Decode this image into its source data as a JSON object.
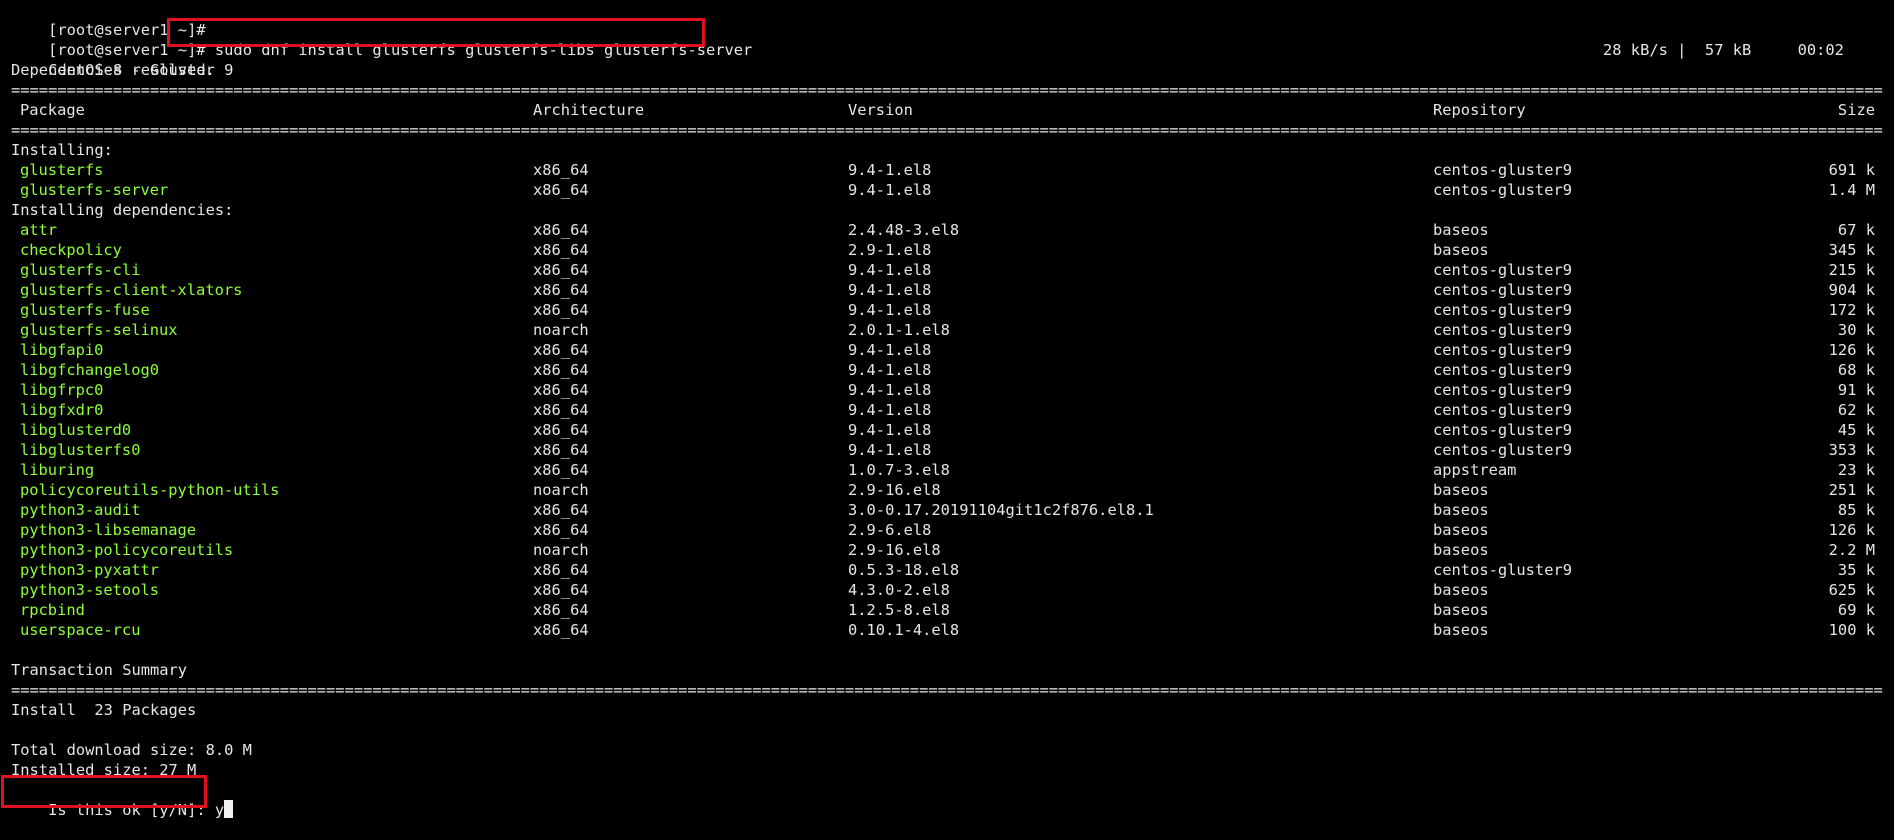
{
  "terminal": {
    "lines": {
      "prompt1": "[root@server1 ~]#",
      "prompt2": "[root@server1 ~]#",
      "command": "sudo dnf install glusterfs glusterfs-libs glusterfs-server",
      "repo_line": "CentOS-8 - Gluster 9",
      "download_stats": "28 kB/s |  57 kB     00:02",
      "deps_resolved": "Dependencies resolved.",
      "installing_header": "Installing:",
      "installing_deps_header": "Installing dependencies:",
      "transaction_summary": "Transaction Summary",
      "install_count": "Install  23 Packages",
      "total_download": "Total download size: 8.0 M",
      "installed_size": "Installed size: 27 M",
      "confirm_prompt": "Is this ok [y/N]: ",
      "confirm_answer": "y"
    },
    "table_headers": {
      "package": "Package",
      "architecture": "Architecture",
      "version": "Version",
      "repository": "Repository",
      "size": "Size"
    },
    "installing": [
      {
        "name": "glusterfs",
        "arch": "x86_64",
        "version": "9.4-1.el8",
        "repo": "centos-gluster9",
        "size": "691 k"
      },
      {
        "name": "glusterfs-server",
        "arch": "x86_64",
        "version": "9.4-1.el8",
        "repo": "centos-gluster9",
        "size": "1.4 M"
      }
    ],
    "dependencies": [
      {
        "name": "attr",
        "arch": "x86_64",
        "version": "2.4.48-3.el8",
        "repo": "baseos",
        "size": "67 k"
      },
      {
        "name": "checkpolicy",
        "arch": "x86_64",
        "version": "2.9-1.el8",
        "repo": "baseos",
        "size": "345 k"
      },
      {
        "name": "glusterfs-cli",
        "arch": "x86_64",
        "version": "9.4-1.el8",
        "repo": "centos-gluster9",
        "size": "215 k"
      },
      {
        "name": "glusterfs-client-xlators",
        "arch": "x86_64",
        "version": "9.4-1.el8",
        "repo": "centos-gluster9",
        "size": "904 k"
      },
      {
        "name": "glusterfs-fuse",
        "arch": "x86_64",
        "version": "9.4-1.el8",
        "repo": "centos-gluster9",
        "size": "172 k"
      },
      {
        "name": "glusterfs-selinux",
        "arch": "noarch",
        "version": "2.0.1-1.el8",
        "repo": "centos-gluster9",
        "size": "30 k"
      },
      {
        "name": "libgfapi0",
        "arch": "x86_64",
        "version": "9.4-1.el8",
        "repo": "centos-gluster9",
        "size": "126 k"
      },
      {
        "name": "libgfchangelog0",
        "arch": "x86_64",
        "version": "9.4-1.el8",
        "repo": "centos-gluster9",
        "size": "68 k"
      },
      {
        "name": "libgfrpc0",
        "arch": "x86_64",
        "version": "9.4-1.el8",
        "repo": "centos-gluster9",
        "size": "91 k"
      },
      {
        "name": "libgfxdr0",
        "arch": "x86_64",
        "version": "9.4-1.el8",
        "repo": "centos-gluster9",
        "size": "62 k"
      },
      {
        "name": "libglusterd0",
        "arch": "x86_64",
        "version": "9.4-1.el8",
        "repo": "centos-gluster9",
        "size": "45 k"
      },
      {
        "name": "libglusterfs0",
        "arch": "x86_64",
        "version": "9.4-1.el8",
        "repo": "centos-gluster9",
        "size": "353 k"
      },
      {
        "name": "liburing",
        "arch": "x86_64",
        "version": "1.0.7-3.el8",
        "repo": "appstream",
        "size": "23 k"
      },
      {
        "name": "policycoreutils-python-utils",
        "arch": "noarch",
        "version": "2.9-16.el8",
        "repo": "baseos",
        "size": "251 k"
      },
      {
        "name": "python3-audit",
        "arch": "x86_64",
        "version": "3.0-0.17.20191104git1c2f876.el8.1",
        "repo": "baseos",
        "size": "85 k"
      },
      {
        "name": "python3-libsemanage",
        "arch": "x86_64",
        "version": "2.9-6.el8",
        "repo": "baseos",
        "size": "126 k"
      },
      {
        "name": "python3-policycoreutils",
        "arch": "noarch",
        "version": "2.9-16.el8",
        "repo": "baseos",
        "size": "2.2 M"
      },
      {
        "name": "python3-pyxattr",
        "arch": "x86_64",
        "version": "0.5.3-18.el8",
        "repo": "centos-gluster9",
        "size": "35 k"
      },
      {
        "name": "python3-setools",
        "arch": "x86_64",
        "version": "4.3.0-2.el8",
        "repo": "baseos",
        "size": "625 k"
      },
      {
        "name": "rpcbind",
        "arch": "x86_64",
        "version": "1.2.5-8.el8",
        "repo": "baseos",
        "size": "69 k"
      },
      {
        "name": "userspace-rcu",
        "arch": "x86_64",
        "version": "0.10.1-4.el8",
        "repo": "baseos",
        "size": "100 k"
      }
    ],
    "colors": {
      "background": "#000000",
      "text": "#e6e6e6",
      "package_name": "#8cff38",
      "highlight_box": "#e0101e"
    }
  }
}
